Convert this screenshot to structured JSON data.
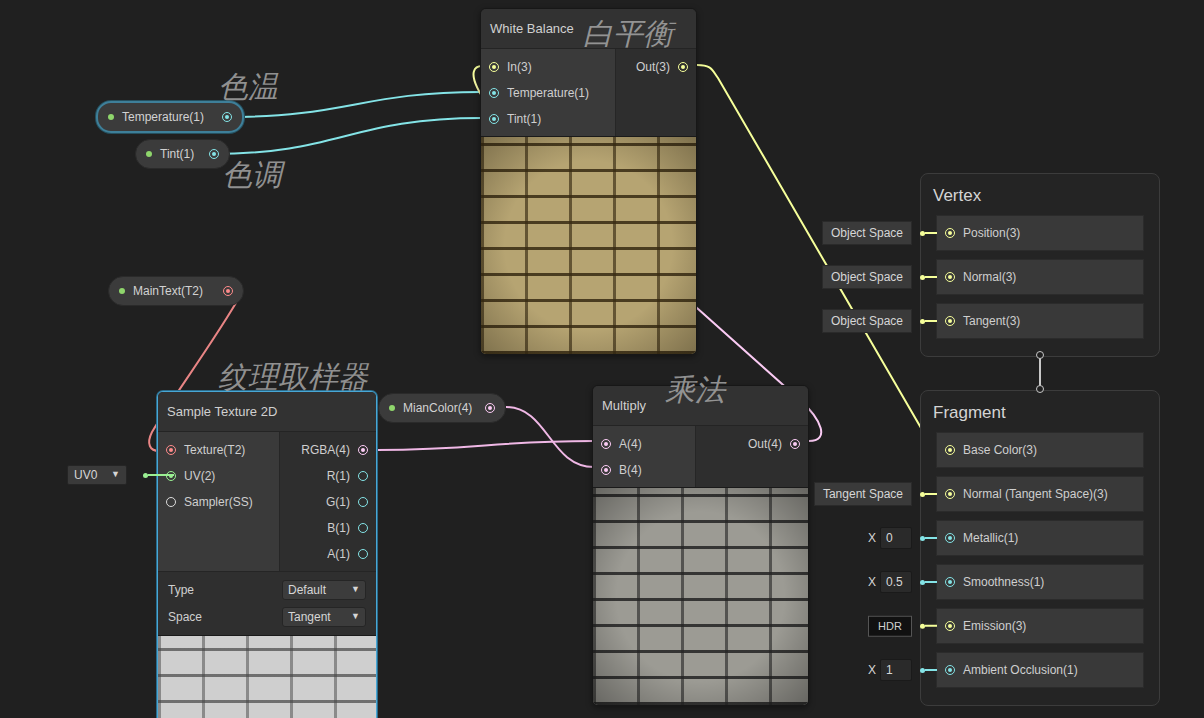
{
  "annotations": {
    "temperature": "色温",
    "tint": "色调",
    "white_balance": "白平衡",
    "sampler": "纹理取样器",
    "multiply": "乘法"
  },
  "properties": [
    {
      "label": "Temperature(1)",
      "selected": true,
      "color": "#84e4e7"
    },
    {
      "label": "Tint(1)",
      "selected": false,
      "color": "#84e4e7"
    },
    {
      "label": "MainText(T2)",
      "selected": false,
      "color": "#ff8b8b"
    },
    {
      "label": "MianColor(4)",
      "selected": false,
      "color": "#fbcbf4"
    }
  ],
  "nodes": {
    "white_balance": {
      "title": "White Balance",
      "selected": false,
      "inputs": [
        {
          "label": "In(3)",
          "color": "#f6ff9a",
          "connected": true
        },
        {
          "label": "Temperature(1)",
          "color": "#84e4e7",
          "connected": true
        },
        {
          "label": "Tint(1)",
          "color": "#84e4e7",
          "connected": true
        }
      ],
      "outputs": [
        {
          "label": "Out(3)",
          "color": "#f6ff9a",
          "connected": true
        }
      ],
      "settings": []
    },
    "sample_texture_2d": {
      "title": "Sample Texture 2D",
      "selected": true,
      "inputs": [
        {
          "label": "Texture(T2)",
          "color": "#ff8b8b",
          "connected": true
        },
        {
          "label": "UV(2)",
          "color": "#9aef92",
          "connected": true
        },
        {
          "label": "Sampler(SS)",
          "color": "#dcdcdc",
          "connected": false
        }
      ],
      "outputs": [
        {
          "label": "RGBA(4)",
          "color": "#fbcbf4",
          "connected": true
        },
        {
          "label": "R(1)",
          "color": "#84e4e7",
          "connected": false
        },
        {
          "label": "G(1)",
          "color": "#84e4e7",
          "connected": false
        },
        {
          "label": "B(1)",
          "color": "#84e4e7",
          "connected": false
        },
        {
          "label": "A(1)",
          "color": "#84e4e7",
          "connected": false
        }
      ],
      "settings": [
        {
          "label": "Type",
          "value": "Default",
          "arrow": "▼"
        },
        {
          "label": "Space",
          "value": "Tangent",
          "arrow": "▼"
        }
      ]
    },
    "multiply": {
      "title": "Multiply",
      "selected": false,
      "inputs": [
        {
          "label": "A(4)",
          "color": "#fbcbf4",
          "connected": true
        },
        {
          "label": "B(4)",
          "color": "#fbcbf4",
          "connected": true
        }
      ],
      "outputs": [
        {
          "label": "Out(4)",
          "color": "#fbcbf4",
          "connected": true
        }
      ],
      "settings": []
    }
  },
  "uv": {
    "value": "UV0",
    "arrow": "▼",
    "color": "#9aef92"
  },
  "vertex": {
    "title": "Vertex",
    "slots": [
      {
        "label": "Position(3)",
        "color": "#f6ff9a",
        "kind": "space",
        "value": "Object Space"
      },
      {
        "label": "Normal(3)",
        "color": "#f6ff9a",
        "kind": "space",
        "value": "Object Space"
      },
      {
        "label": "Tangent(3)",
        "color": "#f6ff9a",
        "kind": "space",
        "value": "Object Space"
      }
    ]
  },
  "fragment": {
    "title": "Fragment",
    "slots": [
      {
        "label": "Base Color(3)",
        "color": "#f6ff9a",
        "kind": "wire"
      },
      {
        "label": "Normal (Tangent Space)(3)",
        "color": "#f6ff9a",
        "kind": "space",
        "value": "Tangent Space"
      },
      {
        "label": "Metallic(1)",
        "color": "#84e4e7",
        "kind": "number",
        "axis": "X",
        "value": "0"
      },
      {
        "label": "Smoothness(1)",
        "color": "#84e4e7",
        "kind": "number",
        "axis": "X",
        "value": "0.5"
      },
      {
        "label": "Emission(3)",
        "color": "#f6ff9a",
        "kind": "hdr",
        "value": "HDR"
      },
      {
        "label": "Ambient Occlusion(1)",
        "color": "#84e4e7",
        "kind": "number",
        "axis": "X",
        "value": "1"
      }
    ]
  }
}
